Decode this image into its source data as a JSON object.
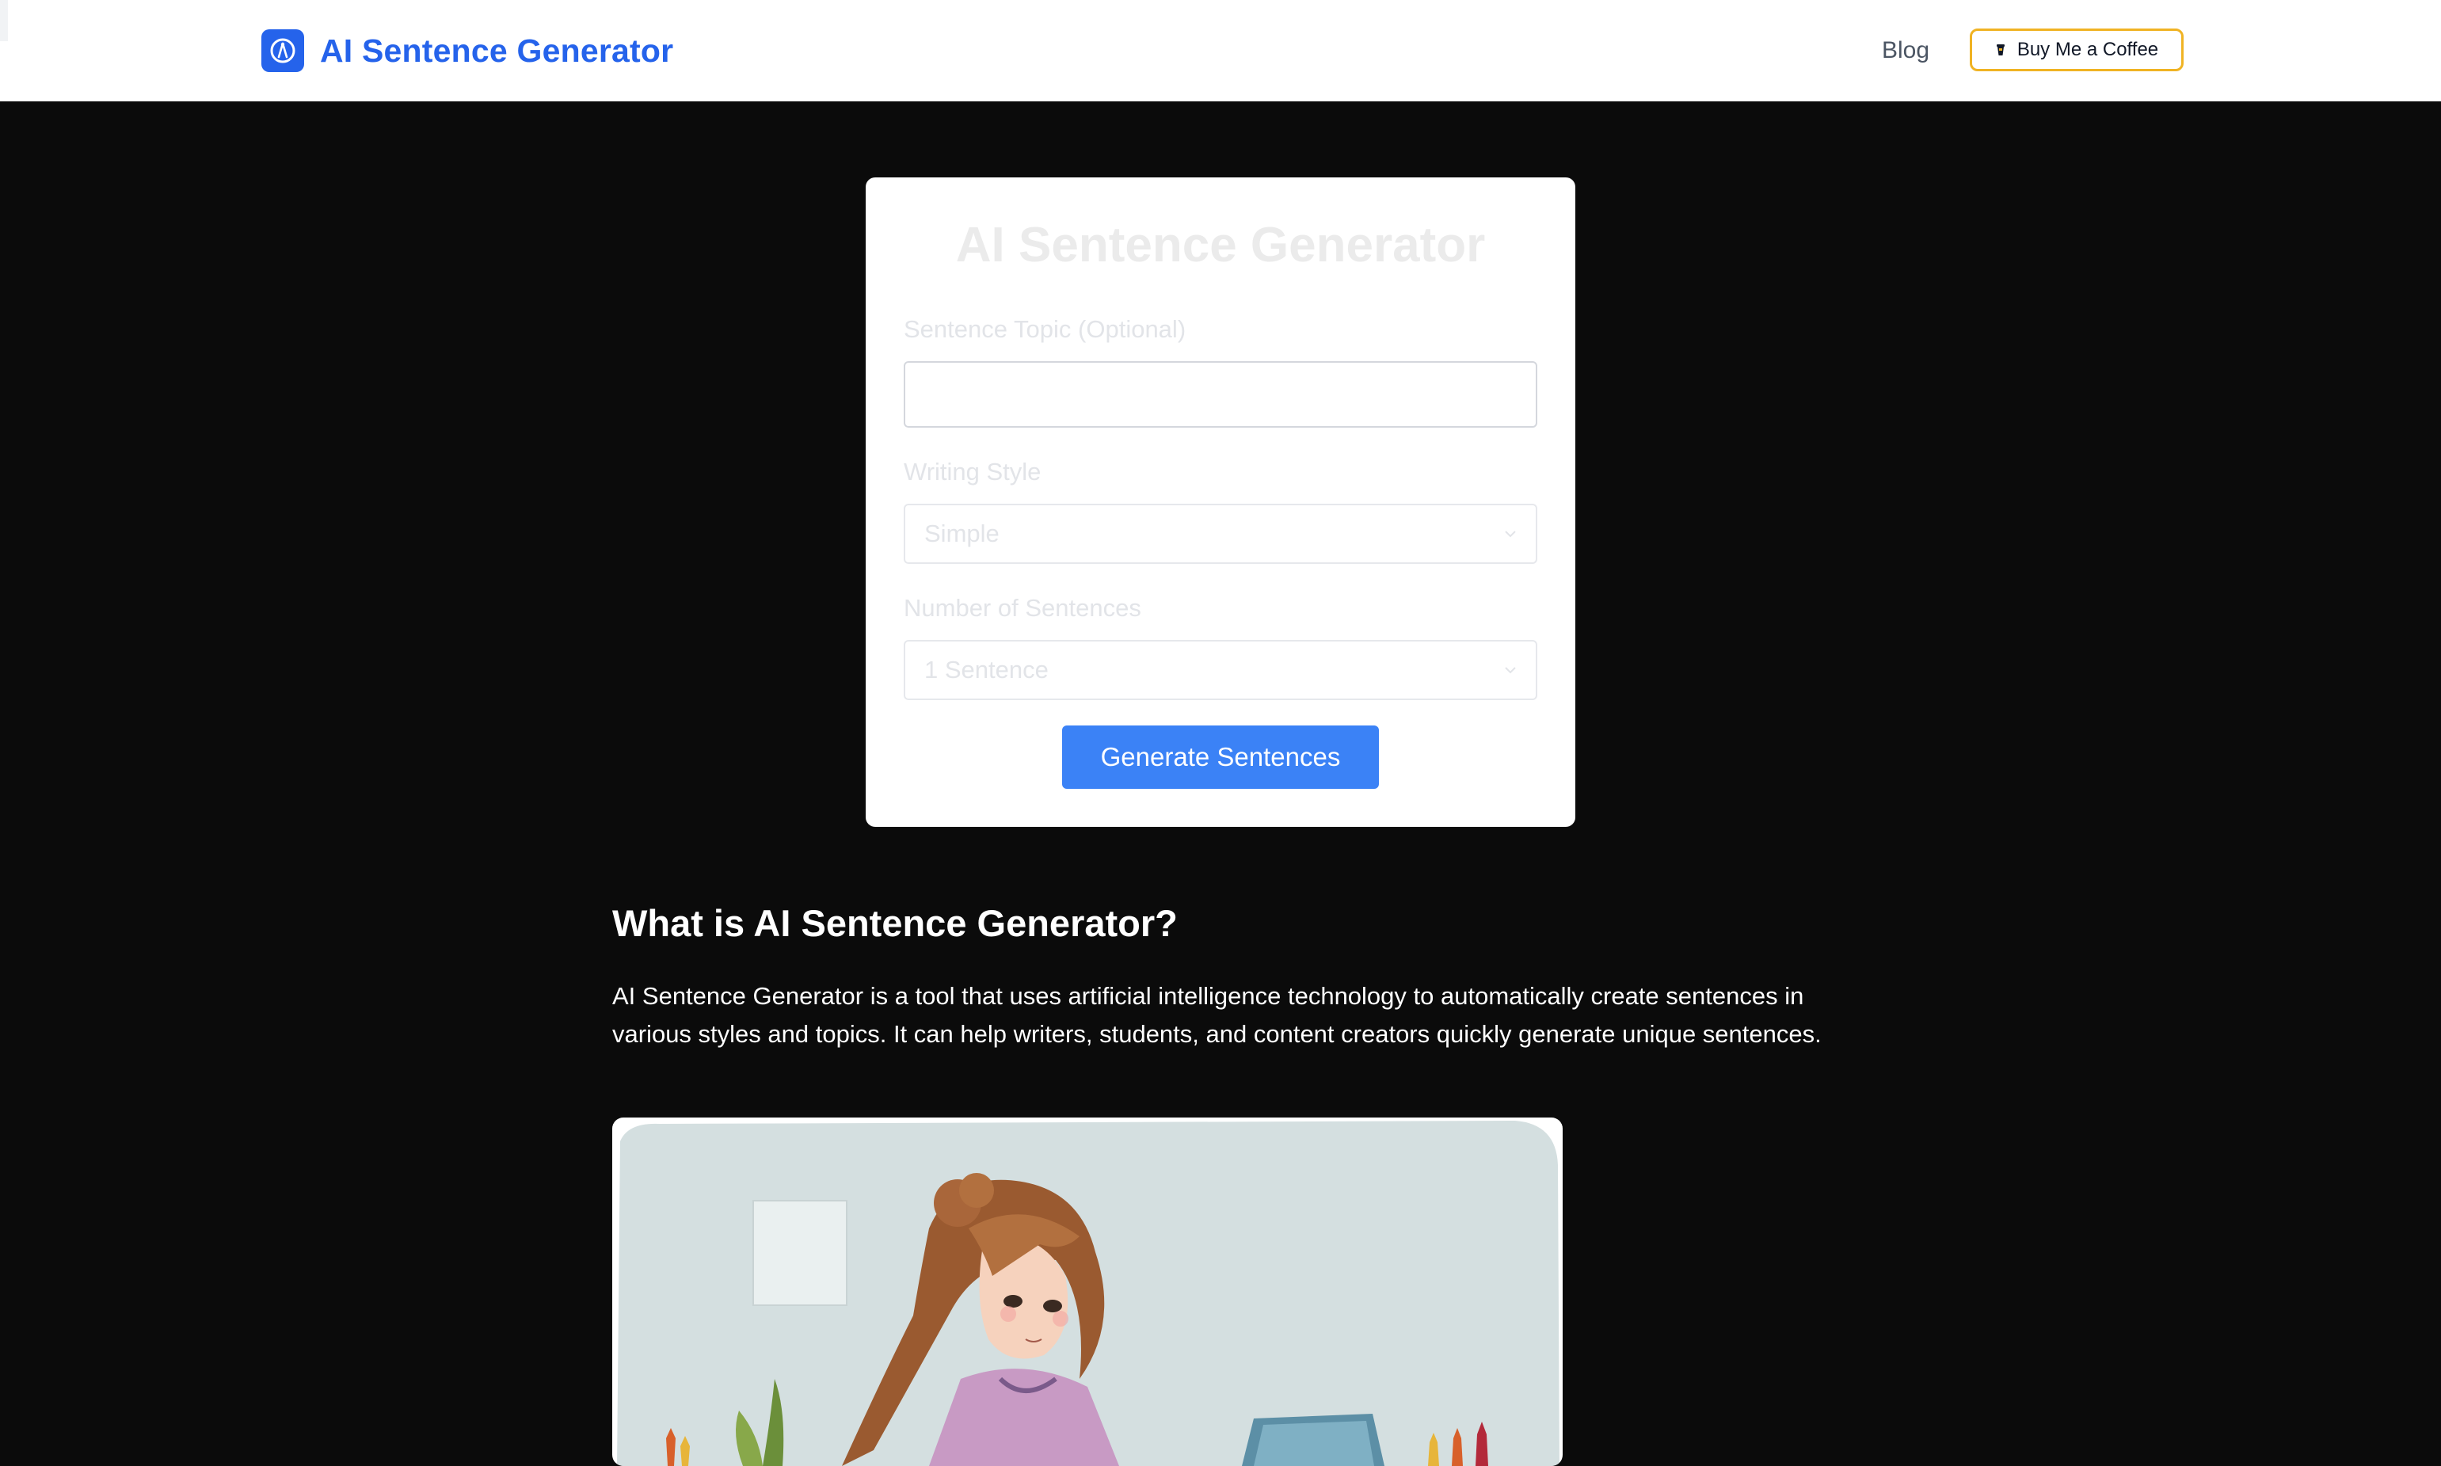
{
  "header": {
    "brand_name": "AI Sentence Generator",
    "brand_icon": "compass-icon",
    "nav": {
      "blog_label": "Blog"
    },
    "coffee_button": {
      "label": "Buy Me a Coffee",
      "icon": "coffee-icon"
    }
  },
  "generator": {
    "title": "AI Sentence Generator",
    "topic_label": "Sentence Topic (Optional)",
    "topic_value": "",
    "style_label": "Writing Style",
    "style_selected": "Simple",
    "count_label": "Number of Sentences",
    "count_selected": "1 Sentence",
    "generate_label": "Generate Sentences"
  },
  "article": {
    "heading": "What is AI Sentence Generator?",
    "paragraph": "AI Sentence Generator is a tool that uses artificial intelligence technology to automatically create sentences in various styles and topics. It can help writers, students, and content creators quickly generate unique sentences."
  },
  "colors": {
    "brand": "#2563eb",
    "button": "#3b82f6",
    "coffee_border": "#f0b323",
    "page_bg": "#0b0b0b"
  }
}
